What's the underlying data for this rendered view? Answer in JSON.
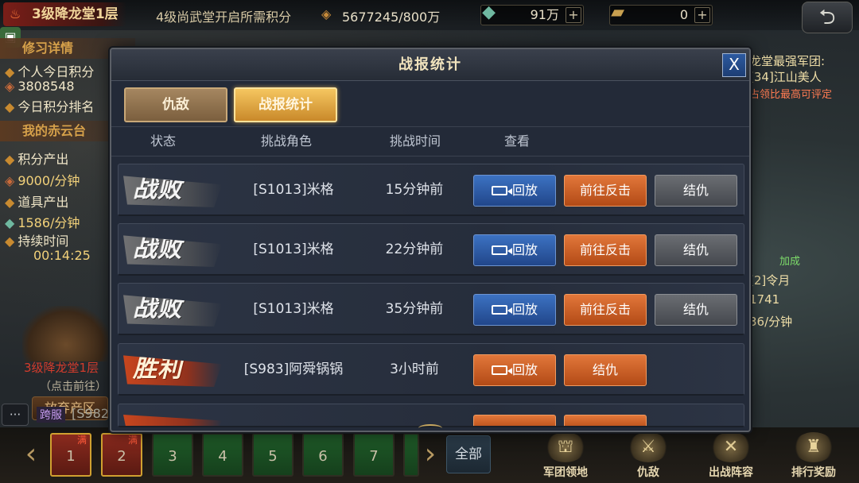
{
  "game": {
    "floor_title": "3级降龙堂1层",
    "unlock_text": "4级尚武堂开启所需积分",
    "unlock_value": "5677245/800万",
    "res_a": "91万",
    "res_b": "0",
    "plus": "+",
    "back_glyph": "⮌"
  },
  "left_panel": {
    "section1": "修习详情",
    "personal_label": "个人今日积分",
    "personal_value": "3808548",
    "rank_label": "今日积分排名",
    "section2": "我的赤云台",
    "score_label": "积分产出",
    "score_value": "9000/分钟",
    "item_label": "道具产出",
    "item_value": "1586/分钟",
    "duration_label": "持续时间",
    "duration_value": "00:14:25",
    "map_name": "3级降龙堂1层",
    "map_sub": "（点击前往）",
    "abandon": "放弃产区"
  },
  "right_info": {
    "l1": "龙堂最强军团:",
    "l2": "[34]江山美人",
    "l3": "占领比最高可评定",
    "add": "加成",
    "l4": "[2]令月",
    "l5": "1741",
    "l6": "36/分钟"
  },
  "chat": {
    "btn": "···",
    "tag": "跨服",
    "text": "[S982"
  },
  "bottom": {
    "slots": [
      "1",
      "2",
      "3",
      "4",
      "5",
      "6",
      "7"
    ],
    "full_tag": "满",
    "all": "全部",
    "menu": [
      "军团领地",
      "仇敌",
      "出战阵容",
      "排行奖励"
    ]
  },
  "modal": {
    "title": "战报统计",
    "close": "X",
    "tabs": [
      "仇敌",
      "战报统计"
    ],
    "columns": [
      "状态",
      "挑战角色",
      "挑战时间",
      "查看"
    ],
    "rows": [
      {
        "status": "战败",
        "role": "[S1013]米格",
        "time": "15分钟前",
        "replay": "回放",
        "counter": "前往反击",
        "feud": "结仇"
      },
      {
        "status": "战败",
        "role": "[S1013]米格",
        "time": "22分钟前",
        "replay": "回放",
        "counter": "前往反击",
        "feud": "结仇"
      },
      {
        "status": "战败",
        "role": "[S1013]米格",
        "time": "35分钟前",
        "replay": "回放",
        "counter": "前往反击",
        "feud": "结仇"
      },
      {
        "status": "胜利",
        "role": "[S983]阿舜锅锅",
        "time": "3小时前",
        "replay": "回放",
        "feud": "结仇"
      }
    ]
  },
  "colors": {
    "blue_btn": "#2c5aa0",
    "orange_btn": "#c85a22",
    "gray_btn": "#55585e",
    "tab_active": "#e3a843"
  }
}
